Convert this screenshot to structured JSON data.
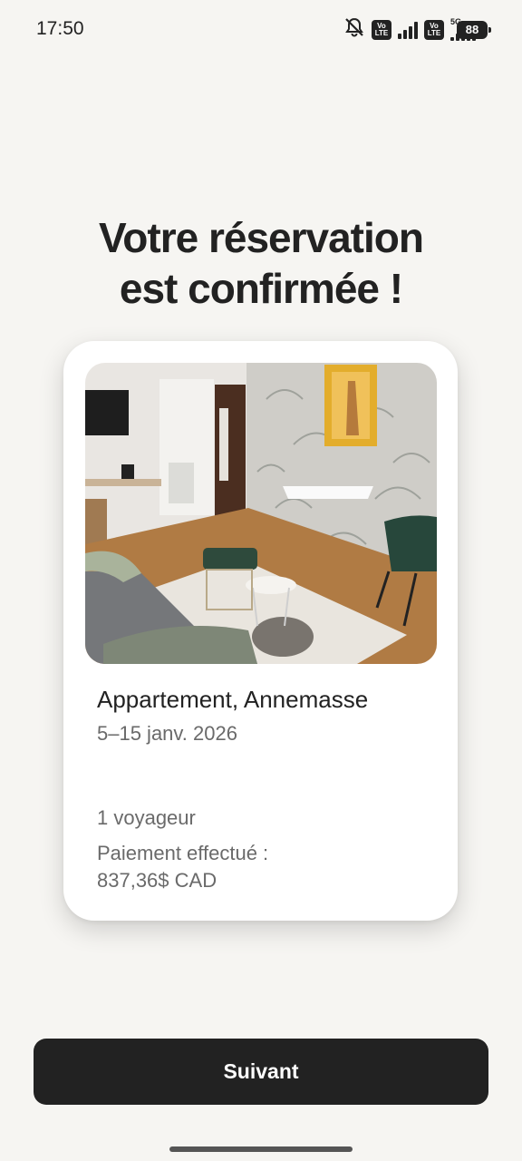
{
  "status_bar": {
    "time": "17:50",
    "icons": [
      "bell-muted-icon",
      "volte-icon",
      "signal-icon",
      "volte-icon",
      "5g-signal-icon",
      "battery-icon"
    ],
    "volte_label_top": "Vo",
    "volte_label_bottom": "LTE",
    "network_label": "5G",
    "battery_level": "88"
  },
  "header": {
    "title_line1": "Votre réservation",
    "title_line2": "est confirmée !"
  },
  "booking": {
    "listing_title": "Appartement, Annemasse",
    "dates": "5–15 janv. 2026",
    "guests": "1 voyageur",
    "payment_label": "Paiement effectué :",
    "payment_amount": "837,36$ CAD"
  },
  "footer": {
    "next_label": "Suivant"
  },
  "colors": {
    "background": "#f6f5f2",
    "card": "#ffffff",
    "button": "#222222",
    "primary_text": "#222222",
    "secondary_text": "#6a6a6a"
  }
}
